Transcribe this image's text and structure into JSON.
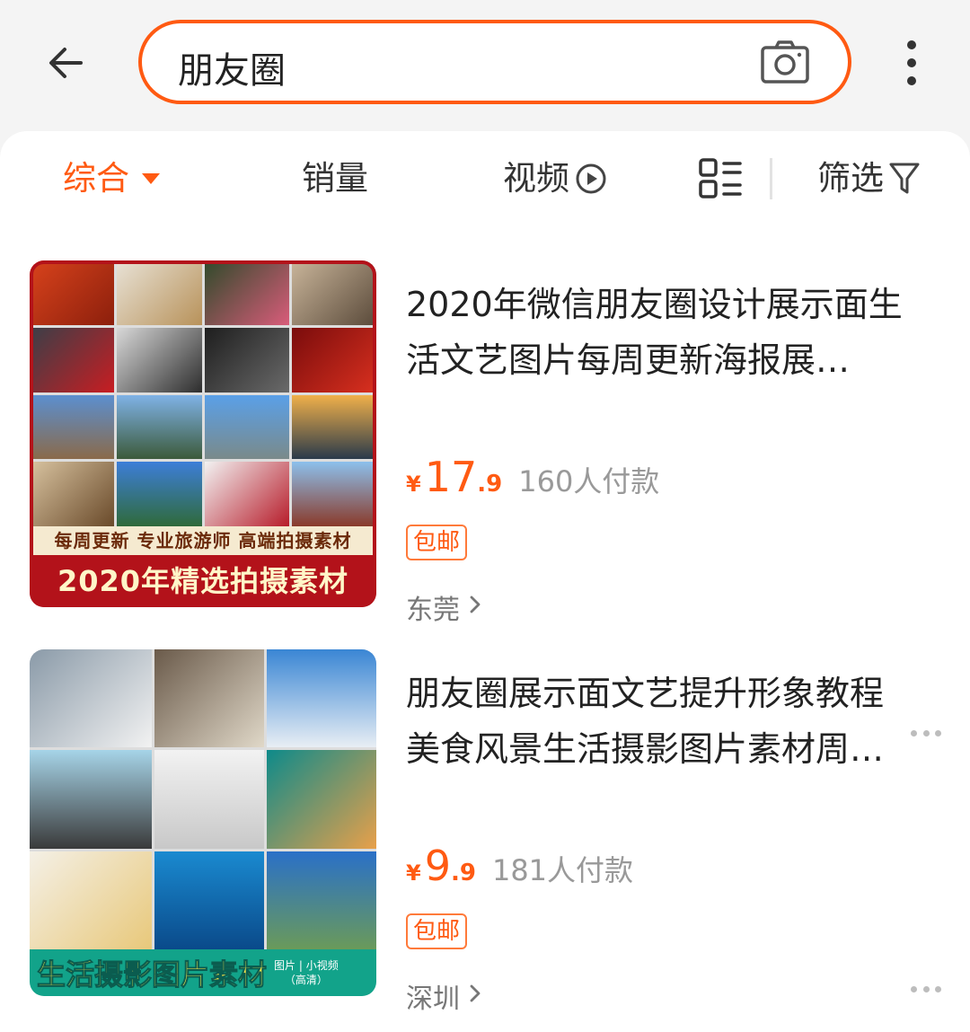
{
  "search": {
    "query": "朋友圈"
  },
  "tabs": {
    "comprehensive": "综合",
    "sales": "销量",
    "video": "视频",
    "filter": "筛选"
  },
  "colors": {
    "accent": "#ff5a12",
    "muted": "#999999",
    "tag_border": "#ff7a3a"
  },
  "products": [
    {
      "title": "2020年微信朋友圈设计展示面生活文艺图片每周更新海报展…",
      "currency": "¥",
      "price_int": "17",
      "price_dec": ".9",
      "sales": "160人付款",
      "tag": "包邮",
      "location": "东莞",
      "thumb_sub": "每周更新  专业旅游师  高端拍摄素材",
      "thumb_main": "2020年精选拍摄素材"
    },
    {
      "title": "朋友圈展示面文艺提升形象教程美食风景生活摄影图片素材周…",
      "currency": "¥",
      "price_int": "9",
      "price_dec": ".9",
      "sales": "181人付款",
      "tag": "包邮",
      "location": "深圳",
      "thumb_main": "生活摄影图片素材",
      "thumb_side_1": "图片 | 小视频",
      "thumb_side_2": "（高清）"
    }
  ]
}
